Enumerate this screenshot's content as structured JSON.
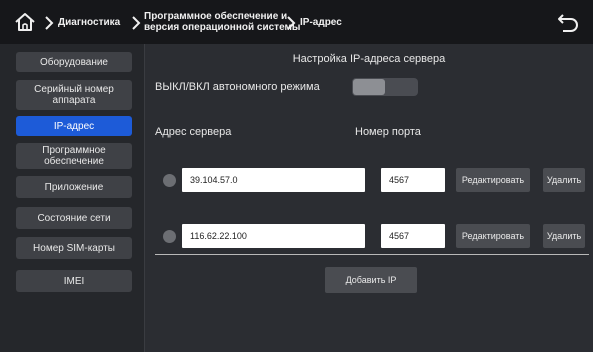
{
  "header": {
    "breadcrumb": {
      "item1": "Диагностика",
      "item2_line1": "Программное обеспечение и",
      "item2_line2": "версия операционной системы",
      "item3": "IP-адрес"
    }
  },
  "sidebar": {
    "items": [
      {
        "label": "Оборудование"
      },
      {
        "label": "Серийный номер аппарата"
      },
      {
        "label": "IP-адрес"
      },
      {
        "label": "Программное обеспечение"
      },
      {
        "label": "Приложение"
      },
      {
        "label": "Состояние сети"
      },
      {
        "label": "Номер SIM-карты"
      },
      {
        "label": "IMEI"
      }
    ],
    "active_index": 2
  },
  "main": {
    "title": "Настройка IP-адреса сервера",
    "offline_toggle": {
      "label": "ВЫКЛ/ВКЛ автономного режима",
      "state": "off"
    },
    "col_server": "Адрес сервера",
    "col_port": "Номер порта",
    "servers": [
      {
        "address": "39.104.57.0",
        "port": "4567",
        "edit": "Редактировать",
        "delete": "Удалить"
      },
      {
        "address": "116.62.22.100",
        "port": "4567",
        "edit": "Редактировать",
        "delete": "Удалить"
      }
    ],
    "add_ip": "Добавить IP"
  },
  "colors": {
    "accent": "#1d5bd8",
    "topbar": "#16171a",
    "background": "#2b2d32"
  }
}
